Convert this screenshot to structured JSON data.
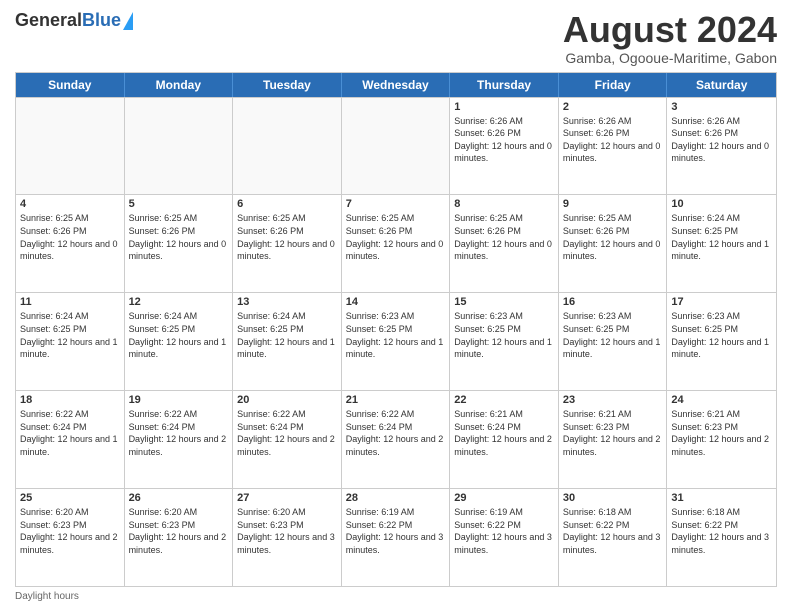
{
  "header": {
    "logo_general": "General",
    "logo_blue": "Blue",
    "main_title": "August 2024",
    "subtitle": "Gamba, Ogooue-Maritime, Gabon"
  },
  "days_of_week": [
    "Sunday",
    "Monday",
    "Tuesday",
    "Wednesday",
    "Thursday",
    "Friday",
    "Saturday"
  ],
  "weeks": [
    [
      {
        "day": "",
        "info": "",
        "empty": true
      },
      {
        "day": "",
        "info": "",
        "empty": true
      },
      {
        "day": "",
        "info": "",
        "empty": true
      },
      {
        "day": "",
        "info": "",
        "empty": true
      },
      {
        "day": "1",
        "info": "Sunrise: 6:26 AM\nSunset: 6:26 PM\nDaylight: 12 hours and 0 minutes.",
        "empty": false
      },
      {
        "day": "2",
        "info": "Sunrise: 6:26 AM\nSunset: 6:26 PM\nDaylight: 12 hours and 0 minutes.",
        "empty": false
      },
      {
        "day": "3",
        "info": "Sunrise: 6:26 AM\nSunset: 6:26 PM\nDaylight: 12 hours and 0 minutes.",
        "empty": false
      }
    ],
    [
      {
        "day": "4",
        "info": "Sunrise: 6:25 AM\nSunset: 6:26 PM\nDaylight: 12 hours and 0 minutes.",
        "empty": false
      },
      {
        "day": "5",
        "info": "Sunrise: 6:25 AM\nSunset: 6:26 PM\nDaylight: 12 hours and 0 minutes.",
        "empty": false
      },
      {
        "day": "6",
        "info": "Sunrise: 6:25 AM\nSunset: 6:26 PM\nDaylight: 12 hours and 0 minutes.",
        "empty": false
      },
      {
        "day": "7",
        "info": "Sunrise: 6:25 AM\nSunset: 6:26 PM\nDaylight: 12 hours and 0 minutes.",
        "empty": false
      },
      {
        "day": "8",
        "info": "Sunrise: 6:25 AM\nSunset: 6:26 PM\nDaylight: 12 hours and 0 minutes.",
        "empty": false
      },
      {
        "day": "9",
        "info": "Sunrise: 6:25 AM\nSunset: 6:26 PM\nDaylight: 12 hours and 0 minutes.",
        "empty": false
      },
      {
        "day": "10",
        "info": "Sunrise: 6:24 AM\nSunset: 6:25 PM\nDaylight: 12 hours and 1 minute.",
        "empty": false
      }
    ],
    [
      {
        "day": "11",
        "info": "Sunrise: 6:24 AM\nSunset: 6:25 PM\nDaylight: 12 hours and 1 minute.",
        "empty": false
      },
      {
        "day": "12",
        "info": "Sunrise: 6:24 AM\nSunset: 6:25 PM\nDaylight: 12 hours and 1 minute.",
        "empty": false
      },
      {
        "day": "13",
        "info": "Sunrise: 6:24 AM\nSunset: 6:25 PM\nDaylight: 12 hours and 1 minute.",
        "empty": false
      },
      {
        "day": "14",
        "info": "Sunrise: 6:23 AM\nSunset: 6:25 PM\nDaylight: 12 hours and 1 minute.",
        "empty": false
      },
      {
        "day": "15",
        "info": "Sunrise: 6:23 AM\nSunset: 6:25 PM\nDaylight: 12 hours and 1 minute.",
        "empty": false
      },
      {
        "day": "16",
        "info": "Sunrise: 6:23 AM\nSunset: 6:25 PM\nDaylight: 12 hours and 1 minute.",
        "empty": false
      },
      {
        "day": "17",
        "info": "Sunrise: 6:23 AM\nSunset: 6:25 PM\nDaylight: 12 hours and 1 minute.",
        "empty": false
      }
    ],
    [
      {
        "day": "18",
        "info": "Sunrise: 6:22 AM\nSunset: 6:24 PM\nDaylight: 12 hours and 1 minute.",
        "empty": false
      },
      {
        "day": "19",
        "info": "Sunrise: 6:22 AM\nSunset: 6:24 PM\nDaylight: 12 hours and 2 minutes.",
        "empty": false
      },
      {
        "day": "20",
        "info": "Sunrise: 6:22 AM\nSunset: 6:24 PM\nDaylight: 12 hours and 2 minutes.",
        "empty": false
      },
      {
        "day": "21",
        "info": "Sunrise: 6:22 AM\nSunset: 6:24 PM\nDaylight: 12 hours and 2 minutes.",
        "empty": false
      },
      {
        "day": "22",
        "info": "Sunrise: 6:21 AM\nSunset: 6:24 PM\nDaylight: 12 hours and 2 minutes.",
        "empty": false
      },
      {
        "day": "23",
        "info": "Sunrise: 6:21 AM\nSunset: 6:23 PM\nDaylight: 12 hours and 2 minutes.",
        "empty": false
      },
      {
        "day": "24",
        "info": "Sunrise: 6:21 AM\nSunset: 6:23 PM\nDaylight: 12 hours and 2 minutes.",
        "empty": false
      }
    ],
    [
      {
        "day": "25",
        "info": "Sunrise: 6:20 AM\nSunset: 6:23 PM\nDaylight: 12 hours and 2 minutes.",
        "empty": false
      },
      {
        "day": "26",
        "info": "Sunrise: 6:20 AM\nSunset: 6:23 PM\nDaylight: 12 hours and 2 minutes.",
        "empty": false
      },
      {
        "day": "27",
        "info": "Sunrise: 6:20 AM\nSunset: 6:23 PM\nDaylight: 12 hours and 3 minutes.",
        "empty": false
      },
      {
        "day": "28",
        "info": "Sunrise: 6:19 AM\nSunset: 6:22 PM\nDaylight: 12 hours and 3 minutes.",
        "empty": false
      },
      {
        "day": "29",
        "info": "Sunrise: 6:19 AM\nSunset: 6:22 PM\nDaylight: 12 hours and 3 minutes.",
        "empty": false
      },
      {
        "day": "30",
        "info": "Sunrise: 6:18 AM\nSunset: 6:22 PM\nDaylight: 12 hours and 3 minutes.",
        "empty": false
      },
      {
        "day": "31",
        "info": "Sunrise: 6:18 AM\nSunset: 6:22 PM\nDaylight: 12 hours and 3 minutes.",
        "empty": false
      }
    ]
  ],
  "footer": {
    "label": "Daylight hours"
  }
}
